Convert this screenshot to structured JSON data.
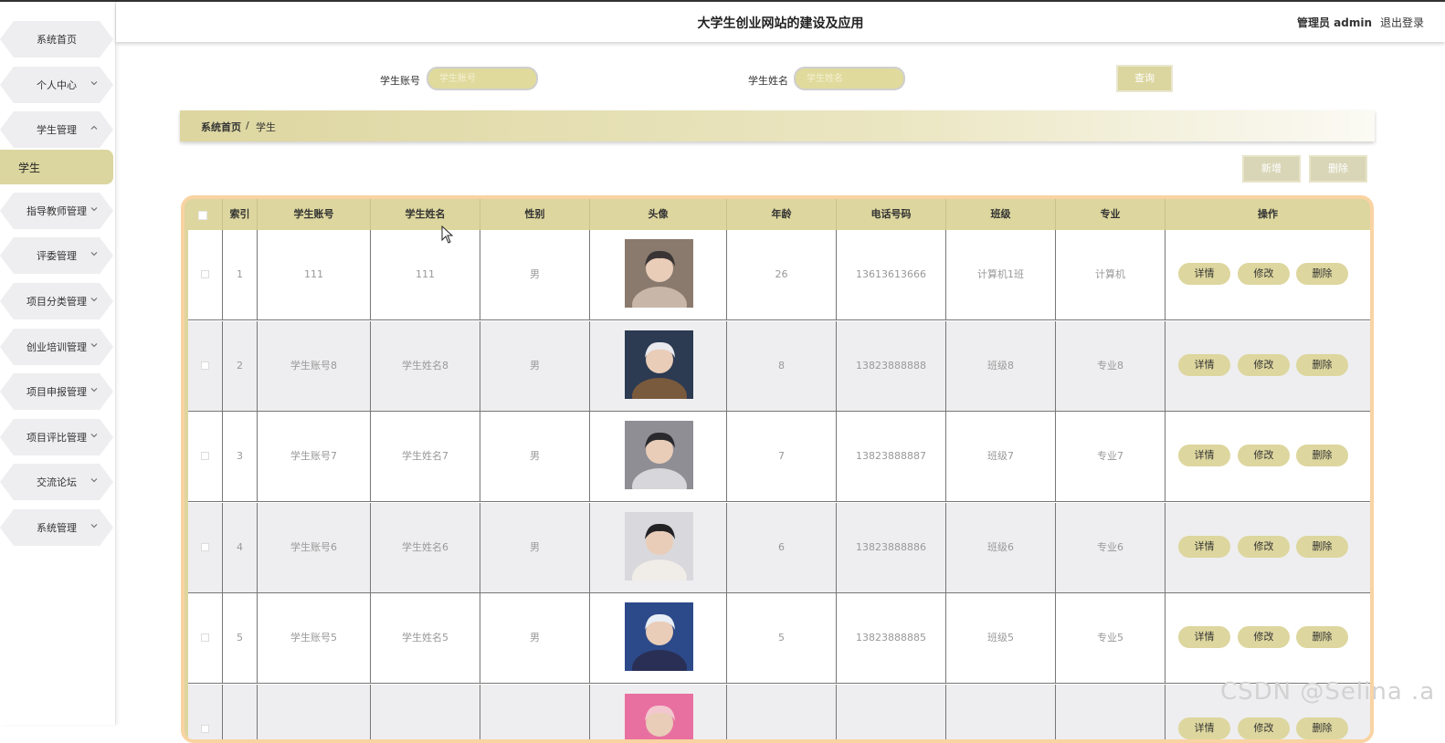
{
  "header": {
    "title": "大学生创业网站的建设及应用",
    "admin_label": "管理员 admin",
    "logout_label": "退出登录"
  },
  "sidebar": {
    "items": [
      {
        "label": "系统首页",
        "has_chevron": false
      },
      {
        "label": "个人中心",
        "has_chevron": true
      },
      {
        "label": "学生管理",
        "has_chevron": true,
        "expanded": true
      },
      {
        "label": "指导教师管理",
        "has_chevron": true
      },
      {
        "label": "评委管理",
        "has_chevron": true
      },
      {
        "label": "项目分类管理",
        "has_chevron": true
      },
      {
        "label": "创业培训管理",
        "has_chevron": true
      },
      {
        "label": "项目申报管理",
        "has_chevron": true
      },
      {
        "label": "项目评比管理",
        "has_chevron": true
      },
      {
        "label": "交流论坛",
        "has_chevron": true
      },
      {
        "label": "系统管理",
        "has_chevron": true
      }
    ],
    "active_sub": "学生"
  },
  "search": {
    "account_label": "学生账号",
    "account_placeholder": "学生账号",
    "name_label": "学生姓名",
    "name_placeholder": "学生姓名",
    "query_button": "查询"
  },
  "breadcrumb": {
    "home": "系统首页",
    "separator": "/",
    "current": "学生"
  },
  "actions": {
    "add": "新增",
    "delete": "删除"
  },
  "table": {
    "columns": [
      "索引",
      "学生账号",
      "学生姓名",
      "性别",
      "头像",
      "年龄",
      "电话号码",
      "班级",
      "专业",
      "操作"
    ],
    "rows": [
      {
        "index": "1",
        "account": "111",
        "name": "111",
        "gender": "男",
        "age": "26",
        "phone": "13613613666",
        "class": "计算机1班",
        "major": "计算机"
      },
      {
        "index": "2",
        "account": "学生账号8",
        "name": "学生姓名8",
        "gender": "男",
        "age": "8",
        "phone": "13823888888",
        "class": "班级8",
        "major": "专业8"
      },
      {
        "index": "3",
        "account": "学生账号7",
        "name": "学生姓名7",
        "gender": "男",
        "age": "7",
        "phone": "13823888887",
        "class": "班级7",
        "major": "专业7"
      },
      {
        "index": "4",
        "account": "学生账号6",
        "name": "学生姓名6",
        "gender": "男",
        "age": "6",
        "phone": "13823888886",
        "class": "班级6",
        "major": "专业6"
      },
      {
        "index": "5",
        "account": "学生账号5",
        "name": "学生姓名5",
        "gender": "男",
        "age": "5",
        "phone": "13823888885",
        "class": "班级5",
        "major": "专业5"
      },
      {
        "index": "",
        "account": "",
        "name": "",
        "gender": "",
        "age": "",
        "phone": "",
        "class": "",
        "major": ""
      }
    ],
    "row_buttons": {
      "detail": "详情",
      "edit": "修改",
      "delete": "删除"
    }
  },
  "watermark": "CSDN @Selina .a",
  "colors": {
    "accent": "#ddd69e",
    "table_border": "#f9d3a2",
    "menu_bg": "#eeeef0"
  }
}
